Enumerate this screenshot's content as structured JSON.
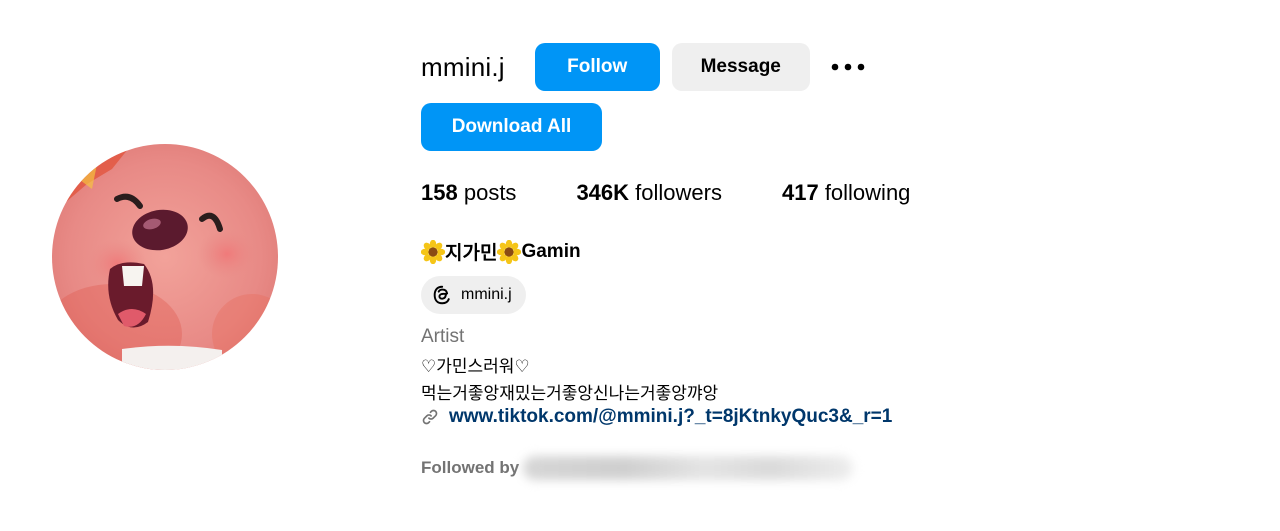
{
  "profile": {
    "username": "mmini.j",
    "full_name": "지가민",
    "full_name_suffix": "Gamin",
    "threads_handle": "mmini.j",
    "category": "Artist",
    "bio_line1": "♡가민스러워♡",
    "bio_line2": "먹는거좋앙재밌는거좋앙신나는거좋앙꺄앙",
    "link": "www.tiktok.com/@mmini.j?_t=8jKtnkyQuc3&_r=1",
    "followed_by_label": "Followed by"
  },
  "actions": {
    "follow_label": "Follow",
    "message_label": "Message",
    "more_icon": "more-options-icon",
    "download_label": "Download All"
  },
  "stats": {
    "posts_count": "158",
    "posts_label": "posts",
    "followers_count": "346K",
    "followers_label": "followers",
    "following_count": "417",
    "following_label": "following"
  },
  "colors": {
    "primary_button": "#0095f6",
    "secondary_button": "#efefef",
    "link": "#00376b",
    "muted": "#737373"
  }
}
